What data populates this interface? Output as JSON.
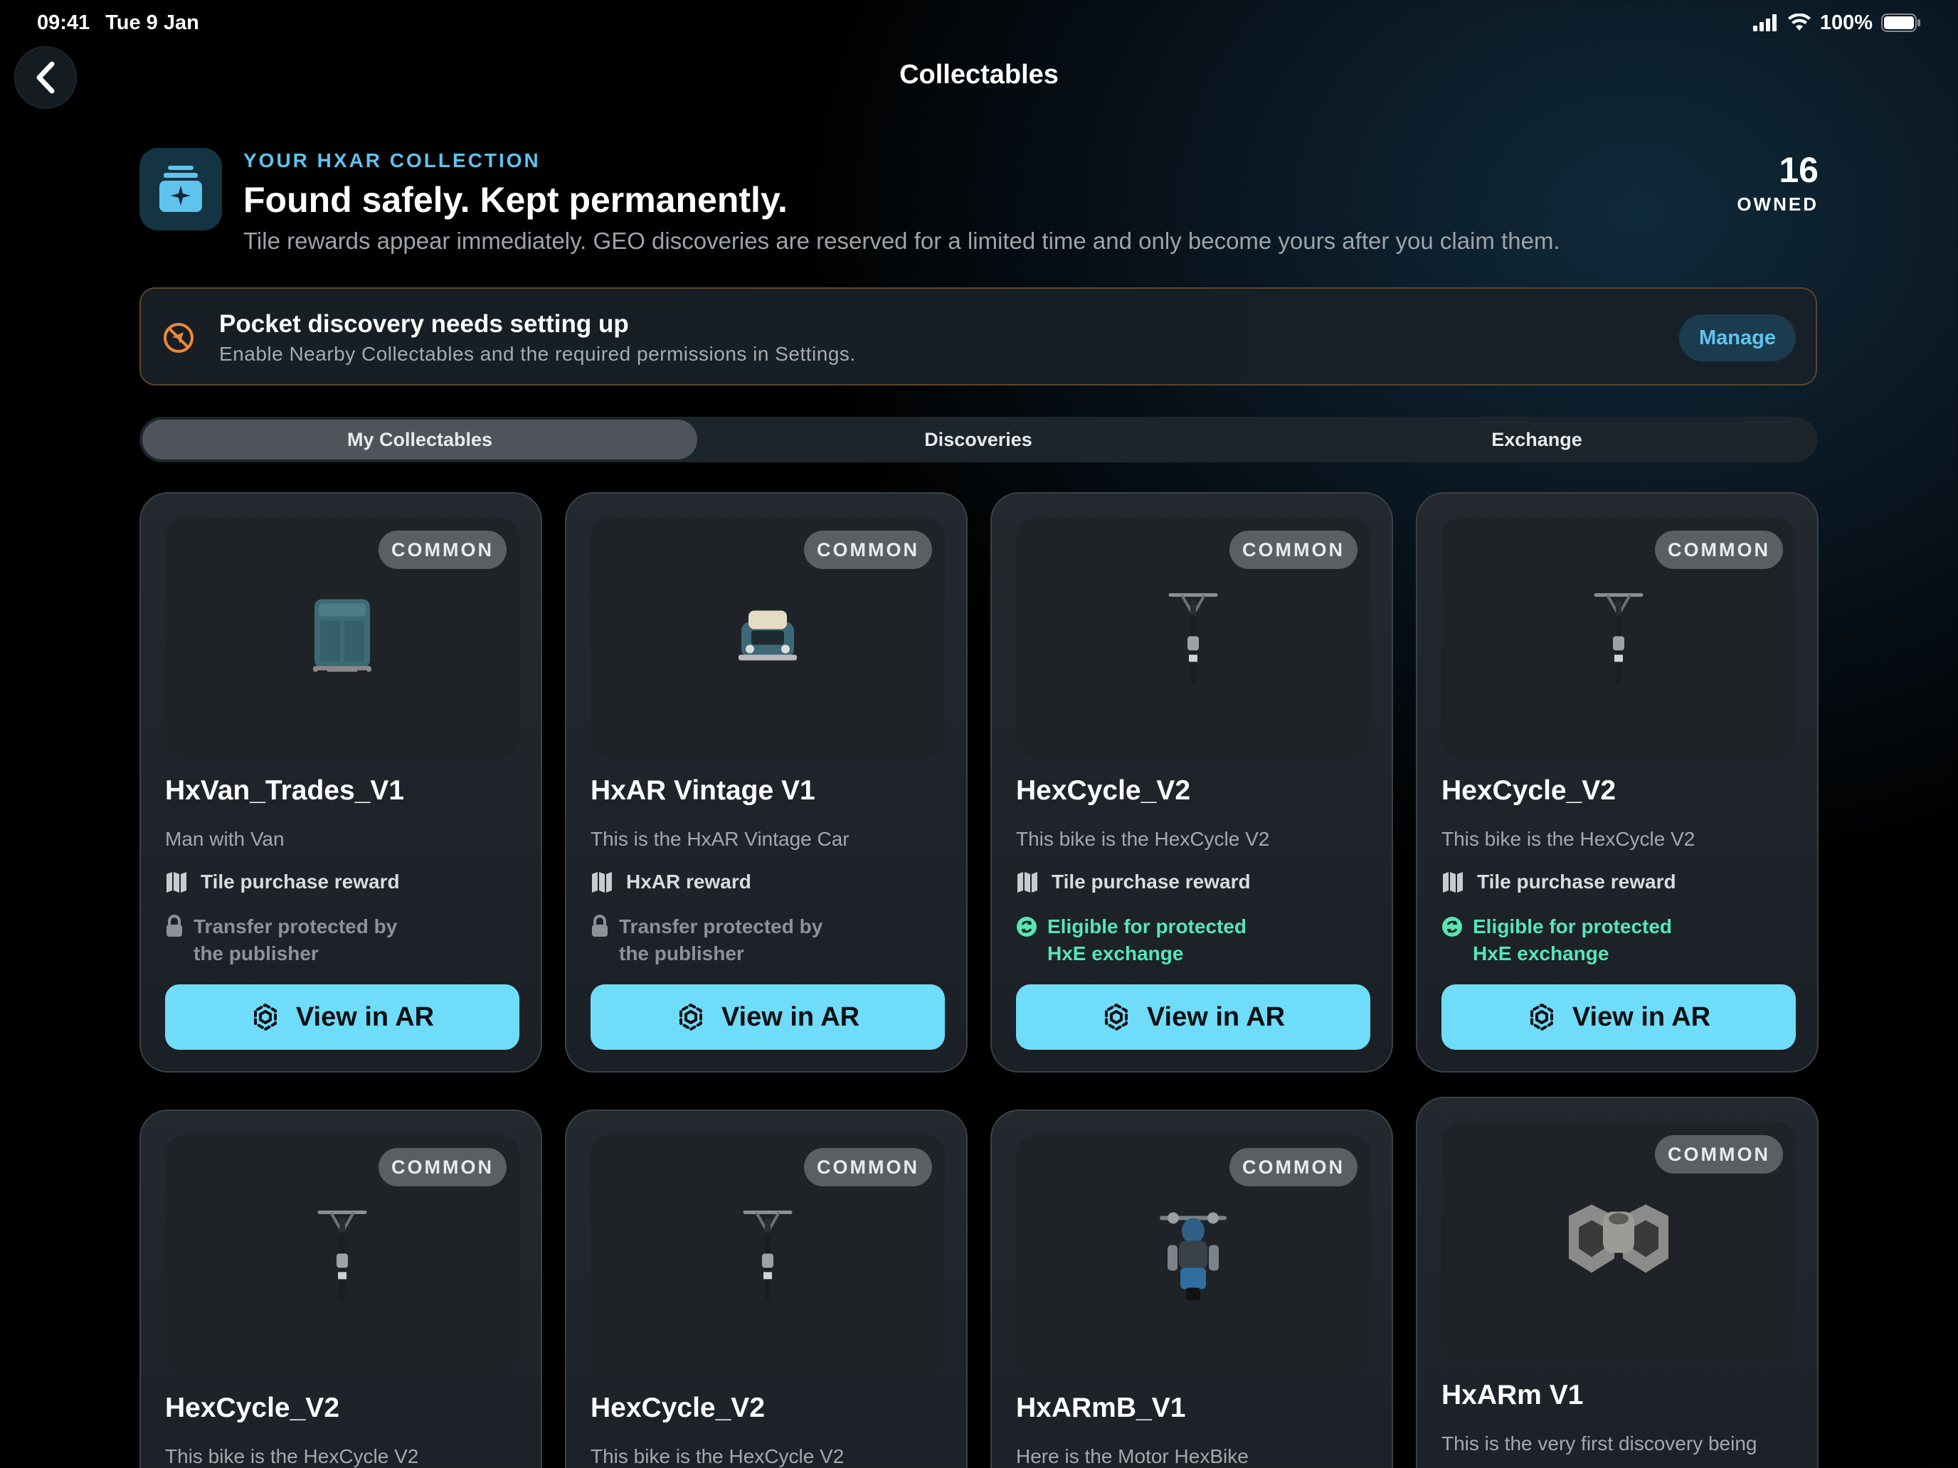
{
  "status_bar": {
    "time": "09:41",
    "date": "Tue 9 Jan",
    "battery": "100%"
  },
  "nav": {
    "title": "Collectables"
  },
  "header": {
    "eyebrow": "YOUR HXAR COLLECTION",
    "title": "Found safely. Kept permanently.",
    "subtitle": "Tile rewards appear immediately. GEO discoveries are reserved for a limited time and only become yours after you claim them.",
    "count": "16",
    "count_label": "OWNED"
  },
  "alert": {
    "title": "Pocket discovery needs setting up",
    "message": "Enable Nearby Collectables and the required permissions in Settings.",
    "action": "Manage"
  },
  "tabs": [
    {
      "label": "My Collectables",
      "selected": true
    },
    {
      "label": "Discoveries",
      "selected": false
    },
    {
      "label": "Exchange",
      "selected": false
    }
  ],
  "colors": {
    "accent": "#5fc3ee",
    "button": "#6fdcfa",
    "warning": "#f0883a",
    "eligible": "#57e6b6"
  },
  "cards": [
    {
      "badge": "COMMON",
      "name": "HxVan_Trades_V1",
      "desc": "Man with Van",
      "reward": "Tile purchase reward",
      "status": "Transfer protected by the publisher",
      "status_type": "locked",
      "action": "View in AR",
      "model": "van"
    },
    {
      "badge": "COMMON",
      "name": "HxAR Vintage V1",
      "desc": "This is the HxAR Vintage Car",
      "reward": "HxAR reward",
      "status": "Transfer protected by the publisher",
      "status_type": "locked",
      "action": "View in AR",
      "model": "car"
    },
    {
      "badge": "COMMON",
      "name": "HexCycle_V2",
      "desc": "This bike is the HexCycle V2",
      "reward": "Tile purchase reward",
      "status": "Eligible for protected HxE exchange",
      "status_type": "eligible",
      "action": "View in AR",
      "model": "bike"
    },
    {
      "badge": "COMMON",
      "name": "HexCycle_V2",
      "desc": "This bike is the HexCycle V2",
      "reward": "Tile purchase reward",
      "status": "Eligible for protected HxE exchange",
      "status_type": "eligible",
      "action": "View in AR",
      "model": "bike"
    },
    {
      "badge": "COMMON",
      "name": "HexCycle_V2",
      "desc": "This bike is the HexCycle V2",
      "model": "bike"
    },
    {
      "badge": "COMMON",
      "name": "HexCycle_V2",
      "desc": "This bike is the HexCycle V2",
      "model": "bike"
    },
    {
      "badge": "COMMON",
      "name": "HxARmB_V1",
      "desc": "Here is the Motor HexBike",
      "model": "motorbike"
    },
    {
      "badge": "COMMON",
      "name": "HxARm V1",
      "desc": "This is the very first discovery being",
      "model": "hxarm"
    }
  ]
}
